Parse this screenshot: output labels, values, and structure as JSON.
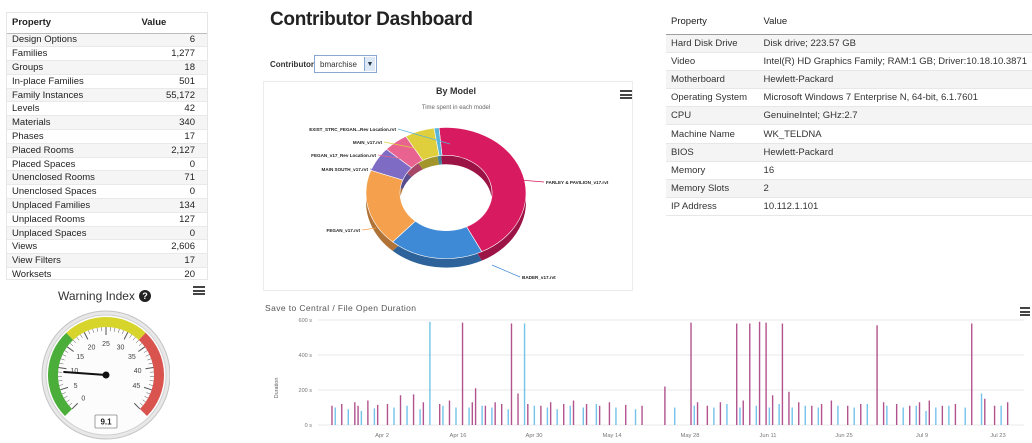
{
  "left_table": {
    "headers": [
      "Property",
      "Value"
    ],
    "rows": [
      [
        "Design Options",
        "6"
      ],
      [
        "Families",
        "1,277"
      ],
      [
        "Groups",
        "18"
      ],
      [
        "In-place Families",
        "501"
      ],
      [
        "Family Instances",
        "55,172"
      ],
      [
        "Levels",
        "42"
      ],
      [
        "Materials",
        "340"
      ],
      [
        "Phases",
        "17"
      ],
      [
        "Placed Rooms",
        "2,127"
      ],
      [
        "Placed Spaces",
        "0"
      ],
      [
        "Unenclosed Rooms",
        "71"
      ],
      [
        "Unenclosed Spaces",
        "0"
      ],
      [
        "Unplaced Families",
        "134"
      ],
      [
        "Unplaced Rooms",
        "127"
      ],
      [
        "Unplaced Spaces",
        "0"
      ],
      [
        "Views",
        "2,606"
      ],
      [
        "View Filters",
        "17"
      ],
      [
        "Worksets",
        "20"
      ]
    ]
  },
  "warning_index": {
    "title": "Warning Index",
    "help_icon": "question-circle-icon",
    "menu_icon": "hamburger-menu-icon",
    "value": 9.1,
    "value_label": "9.1",
    "scale": {
      "min": 0,
      "max": 50
    },
    "tick_labels": [
      "0",
      "5",
      "10",
      "15",
      "20",
      "25",
      "30",
      "35",
      "40",
      "45"
    ],
    "bands": [
      {
        "from": 0,
        "to": 17,
        "color": "#4cae3a"
      },
      {
        "from": 17,
        "to": 33,
        "color": "#d7d52b"
      },
      {
        "from": 33,
        "to": 50,
        "color": "#d9534f"
      }
    ]
  },
  "dashboard": {
    "title": "Contributor Dashboard",
    "contributor_label": "Contributor:",
    "contributor_value": "bmarchise"
  },
  "chart_data": [
    {
      "type": "pie",
      "title": "By Model",
      "subtitle": "Time spent in each model",
      "categories": [
        "FARLEY & PAVILION_v17.rvt",
        "BADER_v17.rvt",
        "FEGAN_v17.rvt",
        "MAIN SOUTH_v17.rvt",
        "FEGAN_v17_Rev Location.rvt",
        "MAIN_v17.rvt",
        "EXIST_STRC_FEGAN...Rev Location.rvt"
      ],
      "values": [
        44,
        19,
        19,
        6,
        5,
        6,
        1
      ],
      "colors": [
        "#d81b60",
        "#3f8ad6",
        "#f4a04c",
        "#7d6bc4",
        "#e8638f",
        "#e0cf3d",
        "#59b6d8"
      ]
    },
    {
      "type": "bar",
      "title": "Save to Central / File Open Duration",
      "ylabel": "Duration",
      "ylim": [
        0,
        600
      ],
      "y_ticks": [
        "0 s",
        "200 s",
        "400 s",
        "600 s"
      ],
      "x_ticks": [
        "Apr 2",
        "Apr 16",
        "Apr 30",
        "May 14",
        "May 28",
        "Jun 11",
        "Jun 25",
        "Jul 9",
        "Jul 23"
      ],
      "series": [
        {
          "color": "#a4357a",
          "values": [
            [
              1,
              110
            ],
            [
              4,
              120
            ],
            [
              8,
              130
            ],
            [
              9,
              110
            ],
            [
              12,
              140
            ],
            [
              15,
              115
            ],
            [
              18,
              120
            ],
            [
              22,
              170
            ],
            [
              26,
              175
            ],
            [
              29,
              130
            ],
            [
              34,
              120
            ],
            [
              37,
              140
            ],
            [
              41,
              585
            ],
            [
              44,
              130
            ],
            [
              45,
              210
            ],
            [
              48,
              110
            ],
            [
              51,
              130
            ],
            [
              53,
              120
            ],
            [
              56,
              580
            ],
            [
              58,
              180
            ],
            [
              61,
              120
            ],
            [
              65,
              110
            ],
            [
              68,
              130
            ],
            [
              72,
              120
            ],
            [
              75,
              140
            ],
            [
              79,
              120
            ],
            [
              83,
              110
            ],
            [
              86,
              130
            ],
            [
              91,
              115
            ],
            [
              96,
              110
            ],
            [
              103,
              220
            ],
            [
              111,
              585
            ],
            [
              113,
              130
            ],
            [
              116,
              110
            ],
            [
              120,
              130
            ],
            [
              125,
              580
            ],
            [
              127,
              140
            ],
            [
              129,
              580
            ],
            [
              132,
              590
            ],
            [
              134,
              585
            ],
            [
              136,
              170
            ],
            [
              139,
              580
            ],
            [
              141,
              190
            ],
            [
              144,
              130
            ],
            [
              148,
              110
            ],
            [
              151,
              120
            ],
            [
              154,
              140
            ],
            [
              159,
              110
            ],
            [
              163,
              120
            ],
            [
              168,
              570
            ],
            [
              170,
              130
            ],
            [
              174,
              120
            ],
            [
              178,
              110
            ],
            [
              181,
              130
            ],
            [
              184,
              140
            ],
            [
              188,
              110
            ],
            [
              192,
              120
            ],
            [
              197,
              580
            ],
            [
              201,
              150
            ],
            [
              204,
              110
            ],
            [
              208,
              130
            ]
          ]
        },
        {
          "color": "#5bb8e8",
          "values": [
            [
              2,
              100
            ],
            [
              6,
              90
            ],
            [
              10,
              80
            ],
            [
              14,
              95
            ],
            [
              20,
              100
            ],
            [
              24,
              110
            ],
            [
              28,
              90
            ],
            [
              31,
              590
            ],
            [
              35,
              110
            ],
            [
              39,
              100
            ],
            [
              43,
              100
            ],
            [
              47,
              110
            ],
            [
              50,
              100
            ],
            [
              55,
              90
            ],
            [
              60,
              580
            ],
            [
              63,
              110
            ],
            [
              67,
              100
            ],
            [
              70,
              90
            ],
            [
              74,
              110
            ],
            [
              78,
              100
            ],
            [
              82,
              120
            ],
            [
              88,
              100
            ],
            [
              94,
              90
            ],
            [
              106,
              100
            ],
            [
              112,
              110
            ],
            [
              118,
              100
            ],
            [
              122,
              120
            ],
            [
              126,
              100
            ],
            [
              131,
              110
            ],
            [
              135,
              100
            ],
            [
              138,
              120
            ],
            [
              142,
              100
            ],
            [
              146,
              110
            ],
            [
              150,
              100
            ],
            [
              156,
              110
            ],
            [
              161,
              100
            ],
            [
              165,
              120
            ],
            [
              171,
              110
            ],
            [
              176,
              100
            ],
            [
              180,
              110
            ],
            [
              183,
              80
            ],
            [
              186,
              100
            ],
            [
              190,
              110
            ],
            [
              195,
              100
            ],
            [
              200,
              180
            ],
            [
              206,
              110
            ]
          ]
        }
      ]
    }
  ],
  "right_table": {
    "headers": [
      "Property",
      "Value"
    ],
    "rows": [
      [
        "Hard Disk Drive",
        "Disk drive; 223.57 GB"
      ],
      [
        "Video",
        "Intel(R) HD Graphics Family; RAM:1 GB; Driver:10.18.10.3871"
      ],
      [
        "Motherboard",
        "Hewlett-Packard"
      ],
      [
        "Operating System",
        "Microsoft Windows 7 Enterprise N, 64-bit, 6.1.7601"
      ],
      [
        "CPU",
        "GenuineIntel; GHz:2.7"
      ],
      [
        "Machine Name",
        "WK_TELDNA"
      ],
      [
        "BIOS",
        "Hewlett-Packard"
      ],
      [
        "Memory",
        "16"
      ],
      [
        "Memory Slots",
        "2"
      ],
      [
        "IP Address",
        "10.112.1.101"
      ]
    ]
  }
}
